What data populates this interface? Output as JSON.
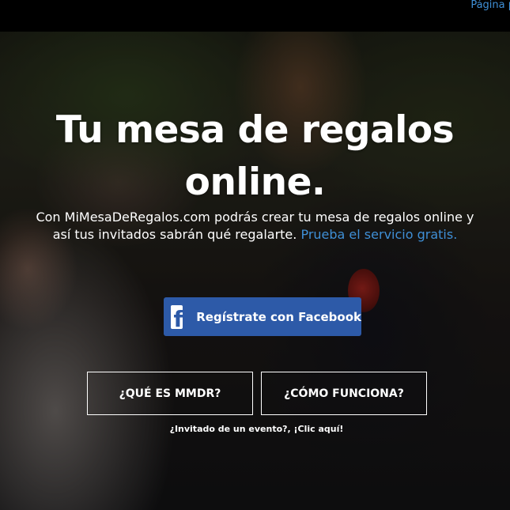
{
  "topbar": {
    "link_label": "Página p"
  },
  "hero": {
    "headline_line1": "Tu mesa de regalos",
    "headline_line2": "online.",
    "sub_line1": "Con MiMesaDeRegalos.com podrás crear tu mesa de regalos online y",
    "sub_line2_prefix": "así tus invitados sabrán qué regalarte.",
    "sub_link": "Prueba el servicio gratis."
  },
  "facebook_button": {
    "icon_glyph": "f",
    "label": "Regístrate con Facebook"
  },
  "buttons": {
    "what_is": "¿QUÉ ES MMDR?",
    "how_it_works": "¿CÓMO FUNCIONA?"
  },
  "guest_link": "¿Invitado de un evento?, ¡Clic aquí!",
  "colors": {
    "link_blue": "#3f8fd6",
    "facebook_blue": "#2d5aa8",
    "topbar": "#000000"
  },
  "icons": {
    "facebook": "facebook-icon"
  }
}
